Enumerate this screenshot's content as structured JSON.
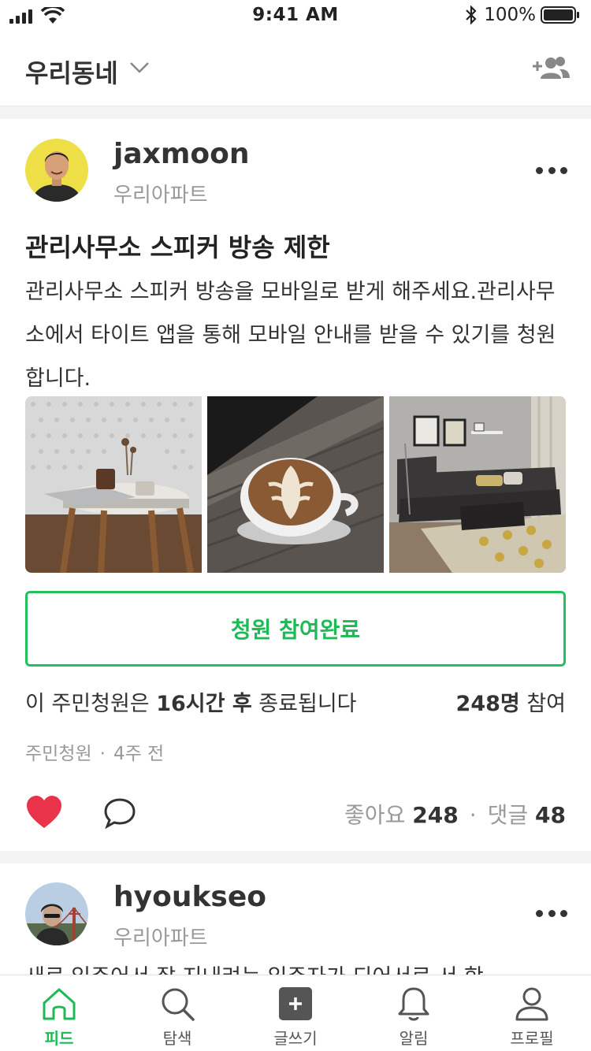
{
  "status_bar": {
    "time": "9:41 AM",
    "battery": "100%"
  },
  "header": {
    "title": "우리동네"
  },
  "posts": [
    {
      "author": "jaxmoon",
      "place": "우리아파트",
      "title": "관리사무소 스피커 방송 제한",
      "body": "관리사무소 스피커 방송을 모바일로 받게 해주세요.관리사무소에서 타이트 앱을 통해 모바일 안내를 받을 수 있기를 청원합니다.",
      "action_label": "청원 참여완료",
      "deadline": {
        "prefix": "이 주민청원은 ",
        "time": "16시간 후",
        "suffix": " 종료됩니다"
      },
      "participants": {
        "count": "248명",
        "suffix": " 참여"
      },
      "category": "주민청원",
      "age": "4주 전",
      "likes_label": "좋아요",
      "likes": "248",
      "comments_label": "댓글",
      "comments": "48"
    },
    {
      "author": "hyoukseo",
      "place": "우리아파트",
      "body_preview": "새로 입주어서 잘 지내려는 입주자가 되어서로 서 함"
    }
  ],
  "tabs": [
    {
      "label": "피드",
      "icon": "home-icon",
      "active": true
    },
    {
      "label": "탐색",
      "icon": "search-icon",
      "active": false
    },
    {
      "label": "글쓰기",
      "icon": "write-icon",
      "active": false
    },
    {
      "label": "알림",
      "icon": "bell-icon",
      "active": false
    },
    {
      "label": "프로필",
      "icon": "profile-icon",
      "active": false
    }
  ],
  "colors": {
    "accent": "#1fb956",
    "heart": "#e8334a",
    "muted": "#999999"
  }
}
